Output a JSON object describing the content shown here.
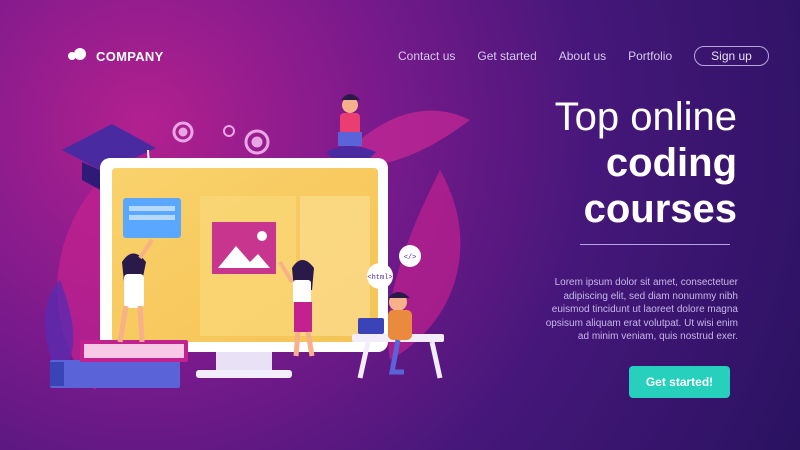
{
  "brand": {
    "name": "COMPANY"
  },
  "nav": {
    "items": [
      "Contact us",
      "Get started",
      "About us",
      "Portfolio"
    ],
    "signup_label": "Sign up"
  },
  "hero": {
    "title_line1": "Top online",
    "title_line2": "coding",
    "title_line3": "courses",
    "body": "Lorem ipsum dolor sit amet, consectetuer adipiscing elit, sed diam nonummy nibh euismod tincidunt ut laoreet dolore magna opsisum aliquam erat volutpat. Ut wisi enim ad minim veniam, quis nostrud exer.",
    "cta_label": "Get started!"
  },
  "illustration": {
    "html_tag": "<html>",
    "code_tag": "</>"
  },
  "colors": {
    "accent": "#27d0bd",
    "background_dark": "#2a1260",
    "background_magenta": "#b3208f"
  }
}
